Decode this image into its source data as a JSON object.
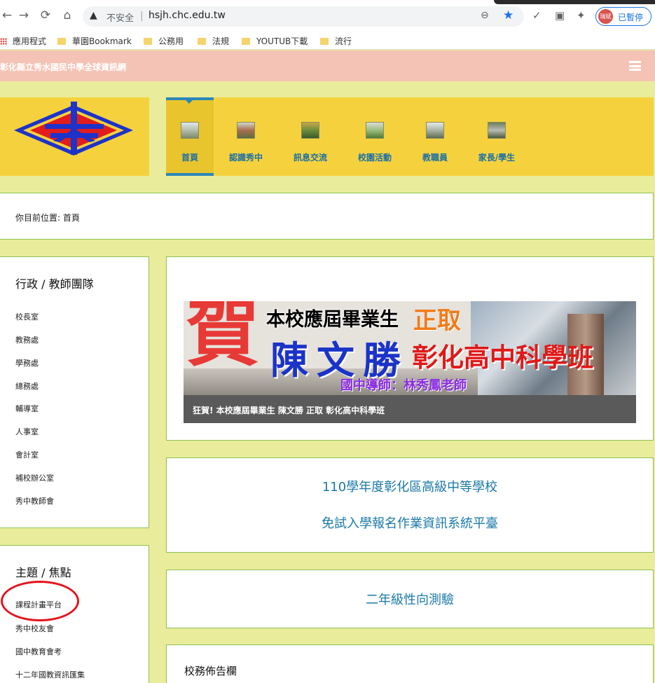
{
  "browser": {
    "insecure_label": "不安全",
    "url": "hsjh.chc.edu.tw",
    "profile_label": "已暫停",
    "profile_avatar": "瑞斌",
    "bookmarks": [
      "應用程式",
      "華園Bookmark",
      "公務用",
      "法規",
      "YOUTUB下載",
      "流行"
    ]
  },
  "site": {
    "title": "彰化縣立秀水國民中學全球資訊網",
    "nav": [
      "首頁",
      "認識秀中",
      "訊息交流",
      "校園活動",
      "教職員",
      "家長/學生"
    ],
    "active_nav": "首頁"
  },
  "breadcrumb": "你目前位置:  首頁",
  "sidebar": {
    "section1_title": "行政 / 教師團隊",
    "section1_items": [
      "校長室",
      "教務處",
      "學務處",
      "總務處",
      "輔導室",
      "人事室",
      "會計室",
      "補校辦公室",
      "秀中教師會"
    ],
    "section2_title": "主題 / 焦點",
    "section2_items": [
      "課程計畫平台",
      "秀中校友會",
      "國中教育會考",
      "十二年國教資訊匯集"
    ]
  },
  "banner": {
    "big_char": "賀",
    "line1": "本校應屆畢業生",
    "line1_accent": "正取",
    "student_name": "陳文勝",
    "school": "彰化高中科學班",
    "mentor": "國中導師：林秀鳳老師",
    "caption": "狂賀! 本校應屆畢業生 陳文勝 正取 彰化高中科學班"
  },
  "notices": {
    "notice1_line1": "110學年度彰化區高級中等學校",
    "notice1_line2": "免試入學報名作業資訊系統平臺",
    "notice2": "二年級性向測驗",
    "board_title": "校務佈告欄"
  },
  "colors": {
    "page_bg": "#e9ec9b",
    "header_bar": "#f5c3b5",
    "nav_bg": "#f5d23d",
    "link_blue": "#1a78a8",
    "panel_border": "#8cc152",
    "annotation_red": "#e4141e"
  }
}
